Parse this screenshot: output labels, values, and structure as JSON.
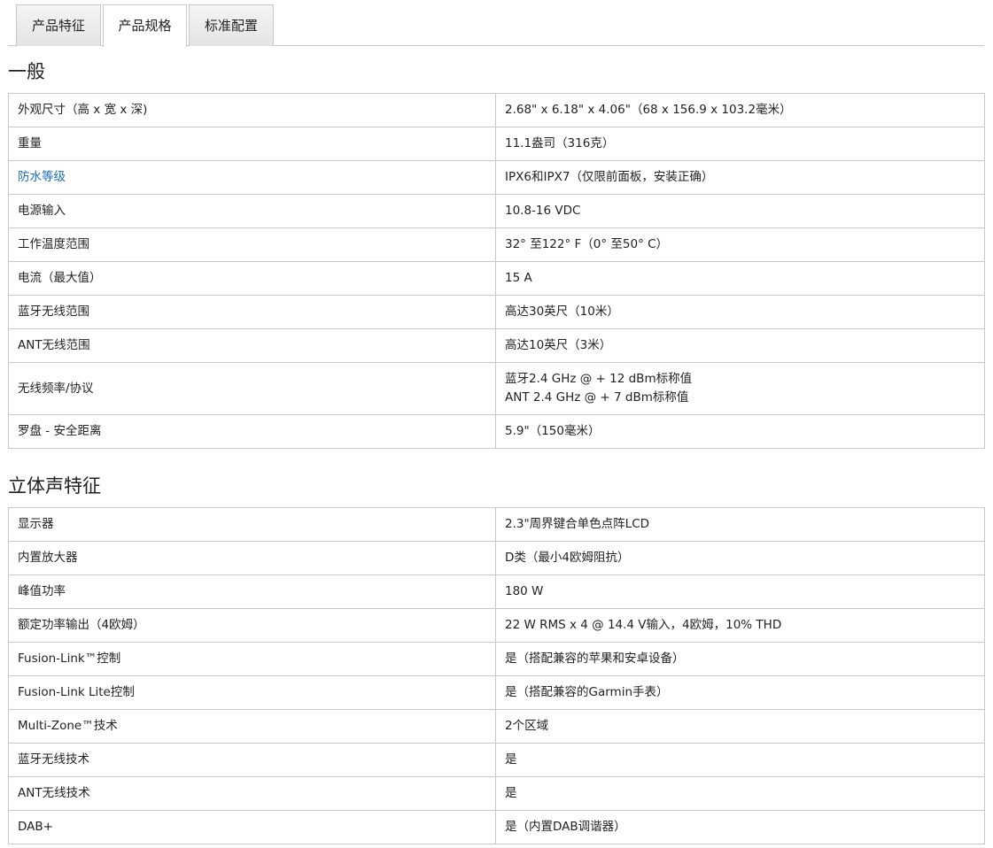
{
  "tabs": [
    {
      "label": "产品特征",
      "active": false
    },
    {
      "label": "产品规格",
      "active": true
    },
    {
      "label": "标准配置",
      "active": false
    }
  ],
  "sections": [
    {
      "title": "一般",
      "rows": [
        {
          "label": "外观尺寸（高 x 宽 x 深)",
          "value": "2.68\" x 6.18\" x 4.06\"（68 x 156.9 x 103.2毫米）"
        },
        {
          "label": "重量",
          "value": "11.1盎司（316克）"
        },
        {
          "label": "防水等级",
          "value": "IPX6和IPX7（仅限前面板，安装正确）",
          "label_is_link": true
        },
        {
          "label": "电源输入",
          "value": "10.8-16 VDC"
        },
        {
          "label": "工作温度范围",
          "value": "32° 至122° F（0° 至50° C）"
        },
        {
          "label": "电流（最大值）",
          "value": "15 A"
        },
        {
          "label": "蓝牙无线范围",
          "value": "高达30英尺（10米）"
        },
        {
          "label": "ANT无线范围",
          "value": "高达10英尺（3米）"
        },
        {
          "label": "无线频率/协议",
          "value_lines": [
            "蓝牙2.4 GHz @ + 12 dBm标称值",
            "ANT 2.4 GHz @ + 7 dBm标称值"
          ]
        },
        {
          "label": "罗盘 - 安全距离",
          "value": "5.9\"（150毫米）"
        }
      ]
    },
    {
      "title": "立体声特征",
      "rows": [
        {
          "label": "显示器",
          "value": "2.3\"周界键合单色点阵LCD"
        },
        {
          "label": "内置放大器",
          "value": "D类（最小4欧姆阻抗）"
        },
        {
          "label": "峰值功率",
          "value": "180 W"
        },
        {
          "label": "额定功率输出（4欧姆）",
          "value": "22 W RMS x 4 @ 14.4 V输入，4欧姆，10% THD"
        },
        {
          "label": "Fusion-Link™控制",
          "value": "是（搭配兼容的苹果和安卓设备）"
        },
        {
          "label": "Fusion-Link Lite控制",
          "value": "是（搭配兼容的Garmin手表）"
        },
        {
          "label": "Multi-Zone™技术",
          "value": "2个区域"
        },
        {
          "label": "蓝牙无线技术",
          "value": "是"
        },
        {
          "label": "ANT无线技术",
          "value": "是"
        },
        {
          "label": "DAB+",
          "value": "是（内置DAB调谐器）"
        }
      ]
    }
  ],
  "colors": {
    "link": "#1a6fb5",
    "border": "#c8c8c8",
    "text": "#222222"
  }
}
